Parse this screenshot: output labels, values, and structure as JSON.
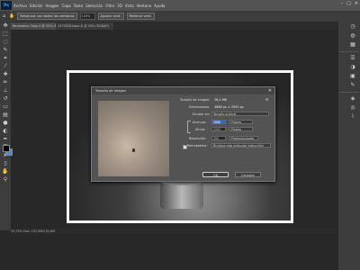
{
  "app": {
    "logo": "Ps"
  },
  "menu": [
    "Archivo",
    "Edición",
    "Imagen",
    "Capa",
    "Texto",
    "Selección",
    "Filtro",
    "3D",
    "Vista",
    "Ventana",
    "Ayuda"
  ],
  "window_controls": {
    "minimize": "–",
    "maximize": "□",
    "close": "✕"
  },
  "options_bar": {
    "buttons": [
      "Restaurar con todas las ventanas",
      "HDR",
      "Ajustar vent.",
      "Rellenar vent."
    ],
    "input": "100%"
  },
  "tabs": [
    {
      "label": "Neumatico Capa 0 @ 33% (RGB/8)*"
    },
    {
      "label": "1579928-base & @ 25% (RGB/8*)"
    }
  ],
  "status": {
    "text": "25,33%   Doc: 102,8M/102,8M"
  },
  "dialog": {
    "title": "Tamaño de imagen",
    "close": "✕",
    "image_size_label": "Tamaño de imagen:",
    "image_size_value": "26,4 MB",
    "dimensions_label": "Dimensiones:",
    "dimensions_value": "3888 px × 2592 px",
    "fit_label": "Encajar en:",
    "fit_value": "Tamaño original",
    "width_label": "Anchura:",
    "width_value": "3888",
    "width_unit": "Píxeles",
    "height_label": "Altura:",
    "height_value": "2592",
    "height_unit": "Píxeles",
    "resolution_label": "Resolución:",
    "resolution_value": "300",
    "resolution_unit": "Píxeles/pulgada",
    "resample_label": "Remuestrear:",
    "resample_value": "Bicúbica más enfocada (reducción)",
    "ok_label": "OK",
    "cancel_label": "Cancelar"
  }
}
